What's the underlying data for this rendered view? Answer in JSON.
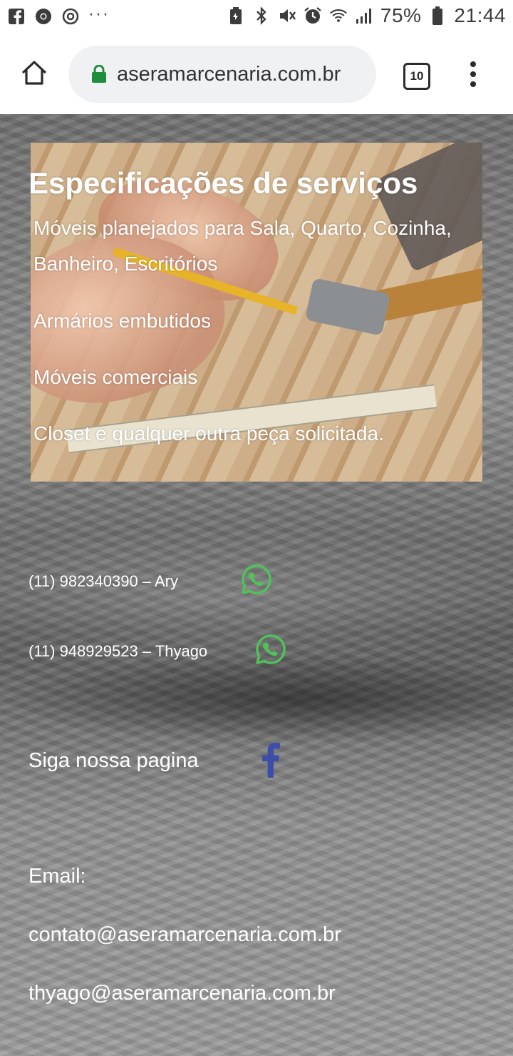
{
  "status_bar": {
    "battery": "75%",
    "time": "21:44",
    "left_icons": [
      "facebook-icon",
      "chrome-icon",
      "sync-icon",
      "more-notifications-icon"
    ],
    "right_icons": [
      "battery-saver-icon",
      "bluetooth-icon",
      "mute-icon",
      "alarm-icon",
      "wifi-icon",
      "signal-icon",
      "battery-icon"
    ]
  },
  "browser": {
    "url": "aseramarcenaria.com.br",
    "tab_count": "10"
  },
  "services": {
    "title": "Especificações de serviços",
    "items": [
      "Móveis planejados para Sala, Quarto, Cozinha, Banheiro, Escritórios",
      "Armários embutidos",
      "Móveis comerciais",
      "Closet e qualquer outra peça solicitada."
    ]
  },
  "contacts": {
    "phones": [
      "(11) 982340390 – Ary",
      "(11) 948929523 – Thyago"
    ],
    "follow_label": "Siga nossa pagina",
    "email_label": "Email:",
    "emails": [
      "contato@aseramarcenaria.com.br",
      "thyago@aseramarcenaria.com.br"
    ]
  },
  "colors": {
    "whatsapp": "#4fc35a",
    "facebook": "#3b4fa8",
    "lock": "#1e8e3e"
  }
}
